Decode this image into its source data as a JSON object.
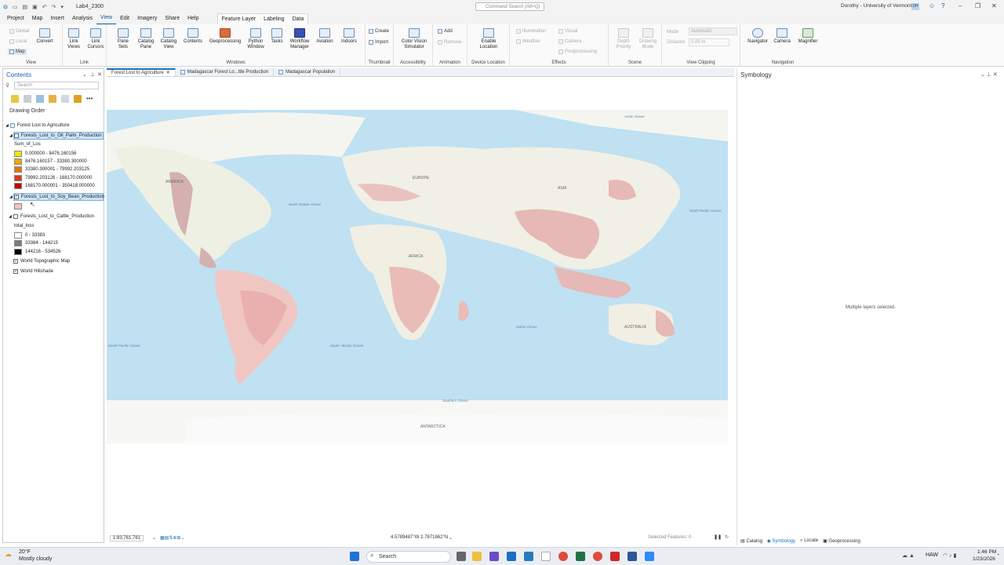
{
  "titlebar": {
    "project_name": "Lab4_2300",
    "command_search": "Command Search (Alt+Q)",
    "user": "Dorothy - University of Vermont",
    "user_initials": "DH"
  },
  "menu": {
    "tabs": [
      "Project",
      "Map",
      "Insert",
      "Analysis",
      "View",
      "Edit",
      "Imagery",
      "Share",
      "Help"
    ],
    "active": "View",
    "context_tabs": [
      "Feature Layer",
      "Labeling",
      "Data"
    ]
  },
  "ribbon": {
    "view": {
      "global": "Global",
      "local": "Local",
      "map": "Map",
      "convert": "Convert",
      "label": "View"
    },
    "link": {
      "link_views": "Link Views",
      "link_cursors": "Link Cursors",
      "label": "Link"
    },
    "windows": {
      "items": [
        "Pane Sets",
        "Catalog Pane",
        "Catalog View",
        "Contents",
        "Geoprocessing",
        "Python Window",
        "Tasks",
        "Workflow Manager",
        "Aviation",
        "Indoors"
      ],
      "label": "Windows"
    },
    "thumbnail": {
      "create": "Create",
      "import": "Import",
      "label": "Thumbnail"
    },
    "accessibility": {
      "color_vision": "Color Vision Simulator",
      "label": "Accessibility"
    },
    "animation": {
      "add": "Add",
      "remove": "Remove",
      "label": "Animation"
    },
    "device_location": {
      "enable": "Enable Location",
      "label": "Device Location"
    },
    "effects": {
      "illumination": "Illumination",
      "weather": "Weather",
      "visual": "Visual",
      "camera": "Camera",
      "postprocessing": "Postprocessing",
      "label": "Effects"
    },
    "scene": {
      "depth_priority": "Depth Priority",
      "drawing_mode": "Drawing Mode",
      "label": "Scene"
    },
    "view_clipping": {
      "mode": "Mode",
      "mode_value": "Automatic",
      "distance": "Distance",
      "distance_value": "0.05 m",
      "label": "View Clipping"
    },
    "navigation": {
      "navigator": "Navigator",
      "camera": "Camera",
      "magnifier": "Magnifier",
      "label": "Navigation"
    }
  },
  "contents": {
    "title": "Contents",
    "search_placeholder": "Search",
    "drawing_order": "Drawing Order",
    "map_name": "Forest Lost to Agriculture",
    "palm": {
      "name": "Forests_Lost_to_Oil_Palm_Production",
      "field": "Sum_of_Los",
      "classes": [
        {
          "label": "0.000000 - 8476.160156",
          "color": "#f3e600"
        },
        {
          "label": "8476.160157 - 33380.300000",
          "color": "#f0a800"
        },
        {
          "label": "33380.300001 - 79992.203125",
          "color": "#e8730a"
        },
        {
          "label": "79992.203126 - 168170.000000",
          "color": "#e0361c"
        },
        {
          "label": "168170.000001 - 350418.000000",
          "color": "#c30000"
        }
      ]
    },
    "soy": {
      "name": "Forests_Lost_to_Soy_Bean_Production",
      "color": "#f3c2bf"
    },
    "cattle": {
      "name": "Forests_Lost_to_Cattle_Production",
      "field": "total_loss",
      "classes": [
        {
          "label": "0 - 33383",
          "color": "#ffffff"
        },
        {
          "label": "33384 - 144215",
          "color": "#7a7a7a"
        },
        {
          "label": "144216 - 534526",
          "color": "#000000"
        }
      ]
    },
    "basemaps": [
      "World Topographic Map",
      "World Hillshade"
    ]
  },
  "map_tabs": [
    "Forest Lost to Agriculture",
    "Madagascar Forest Lo...ttle Production",
    "Madagascar Population"
  ],
  "map_labels": {
    "north_america": "AMERICA",
    "europe": "EUROPE",
    "asia": "ASIA",
    "africa": "AFRICA",
    "australia": "AUSTRALIA",
    "antarctica": "ANTARCTICA",
    "arctic": "Arctic Ocean",
    "north_atlantic": "North Atlantic Ocean",
    "north_pacific": "North Pacific Ocean",
    "south_atlantic": "South Atlantic Ocean",
    "south_pacific": "South Pacific Ocean",
    "indian": "Indian Ocean",
    "southern": "Southern Ocean"
  },
  "status": {
    "scale": "1:83,761,761",
    "coords": "4.5789487°W 2.7871862°N",
    "selected": "Selected Features: 0"
  },
  "symbology": {
    "title": "Symbology",
    "message": "Multiple layers selected."
  },
  "bottom_tabs": [
    "Catalog",
    "Symbology",
    "Locate",
    "Geoprocessing"
  ],
  "taskbar": {
    "temp": "20°F",
    "weather": "Mostly cloudy",
    "search": "Search",
    "lang": "HAW",
    "time": "1:46 PM",
    "date": "1/23/2026"
  }
}
